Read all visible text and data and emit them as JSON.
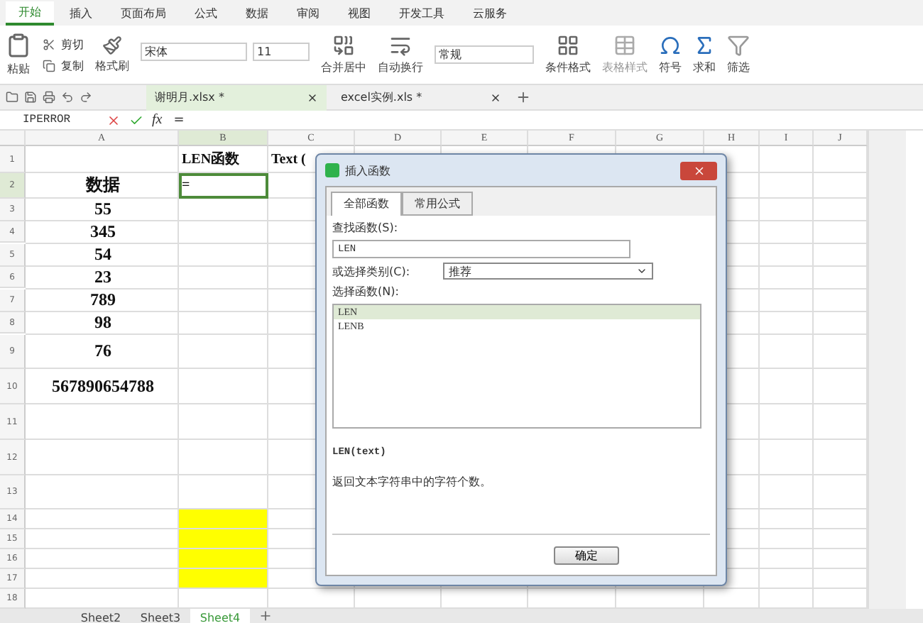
{
  "ribbon_tabs": [
    {
      "label": "开始",
      "selected": true
    },
    {
      "label": "插入",
      "selected": false
    },
    {
      "label": "页面布局",
      "selected": false
    },
    {
      "label": "公式",
      "selected": false
    },
    {
      "label": "数据",
      "selected": false
    },
    {
      "label": "审阅",
      "selected": false
    },
    {
      "label": "视图",
      "selected": false
    },
    {
      "label": "开发工具",
      "selected": false
    },
    {
      "label": "云服务",
      "selected": false
    }
  ],
  "ribbon": {
    "paste": "粘贴",
    "cut": "剪切",
    "copy": "复制",
    "format_painter": "格式刷",
    "font": "宋体",
    "font_size": "11",
    "merge": "合并居中",
    "wrap": "自动换行",
    "number_format": "常规",
    "conditional_format": "条件格式",
    "table_style": "表格样式",
    "symbol": "符号",
    "sum": "求和",
    "filter": "筛选"
  },
  "documents": [
    {
      "name": "谢明月.xlsx *",
      "selected": true
    },
    {
      "name": "excel实例.xls *",
      "selected": false
    }
  ],
  "formula_bar": {
    "name_box": "IPERROR",
    "fx": "fx",
    "formula": "="
  },
  "columns": [
    "A",
    "B",
    "C",
    "D",
    "E",
    "F",
    "G",
    "H",
    "I",
    "J"
  ],
  "rows": [
    {
      "label": "1",
      "cells": {
        "B": "LEN函数",
        "C": "Text ("
      },
      "b_active": false,
      "b_highlighted": false
    },
    {
      "label": "2",
      "cells": {
        "A": "数据",
        "B": "="
      },
      "b_active": true,
      "b_highlighted": false
    },
    {
      "label": "3",
      "cells": {
        "A": "55"
      },
      "b_active": false,
      "b_highlighted": false
    },
    {
      "label": "4",
      "cells": {
        "A": "345"
      },
      "b_active": false,
      "b_highlighted": false
    },
    {
      "label": "5",
      "cells": {
        "A": "54"
      },
      "b_active": false,
      "b_highlighted": false
    },
    {
      "label": "6",
      "cells": {
        "A": "23"
      },
      "b_active": false,
      "b_highlighted": false
    },
    {
      "label": "7",
      "cells": {
        "A": "789"
      },
      "b_active": false,
      "b_highlighted": false
    },
    {
      "label": "8",
      "cells": {
        "A": "98"
      },
      "b_active": false,
      "b_highlighted": false
    },
    {
      "label": "9",
      "cells": {
        "A": "76"
      },
      "b_active": false,
      "b_highlighted": false
    },
    {
      "label": "10",
      "cells": {
        "A": "567890654788"
      },
      "b_active": false,
      "b_highlighted": false
    },
    {
      "label": "11",
      "cells": {},
      "b_active": false,
      "b_highlighted": false
    },
    {
      "label": "12",
      "cells": {},
      "b_active": false,
      "b_highlighted": false
    },
    {
      "label": "13",
      "cells": {},
      "b_active": false,
      "b_highlighted": false
    },
    {
      "label": "14",
      "cells": {},
      "b_active": false,
      "b_highlighted": true
    },
    {
      "label": "15",
      "cells": {},
      "b_active": false,
      "b_highlighted": true
    },
    {
      "label": "16",
      "cells": {},
      "b_active": false,
      "b_highlighted": true
    },
    {
      "label": "17",
      "cells": {},
      "b_active": false,
      "b_highlighted": true
    },
    {
      "label": "18",
      "cells": {},
      "b_active": false,
      "b_highlighted": false
    }
  ],
  "sheet_tabs": [
    {
      "label": "Sheet2",
      "selected": false
    },
    {
      "label": "Sheet3",
      "selected": false
    },
    {
      "label": "Sheet4",
      "selected": true
    }
  ],
  "dialog": {
    "title": "插入函数",
    "tabs": [
      {
        "label": "全部函数",
        "selected": true
      },
      {
        "label": "常用公式",
        "selected": false
      }
    ],
    "search_label": "查找函数(S):",
    "search_value": "LEN",
    "category_label": "或选择类别(C):",
    "category_value": "推荐",
    "list_label": "选择函数(N):",
    "functions": [
      {
        "name": "LEN",
        "selected": true
      },
      {
        "name": "LENB",
        "selected": false
      }
    ],
    "signature": "LEN(text)",
    "description": "返回文本字符串中的字符个数。",
    "ok": "确定"
  }
}
